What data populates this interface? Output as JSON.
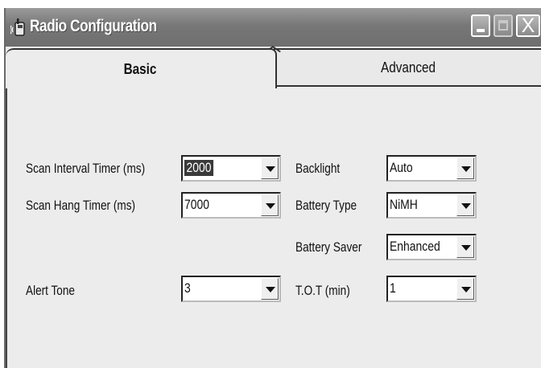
{
  "window": {
    "title": "Radio Configuration",
    "icon": "radio-handset-icon",
    "controls": {
      "minimize": "minimize-icon",
      "maximize": "maximize-icon",
      "close": "X"
    }
  },
  "tabs": [
    {
      "label": "Basic",
      "active": true
    },
    {
      "label": "Advanced",
      "active": false
    }
  ],
  "fields": {
    "scan_interval": {
      "label": "Scan Interval Timer (ms)",
      "value": "2000"
    },
    "scan_hang": {
      "label": "Scan Hang Timer (ms)",
      "value": "7000"
    },
    "alert_tone": {
      "label": "Alert Tone",
      "value": "3"
    },
    "backlight": {
      "label": "Backlight",
      "value": "Auto"
    },
    "battery_type": {
      "label": "Battery Type",
      "value": "NiMH"
    },
    "battery_saver": {
      "label": "Battery Saver",
      "value": "Enhanced"
    },
    "tot": {
      "label": "T.O.T (min)",
      "value": "1"
    }
  }
}
